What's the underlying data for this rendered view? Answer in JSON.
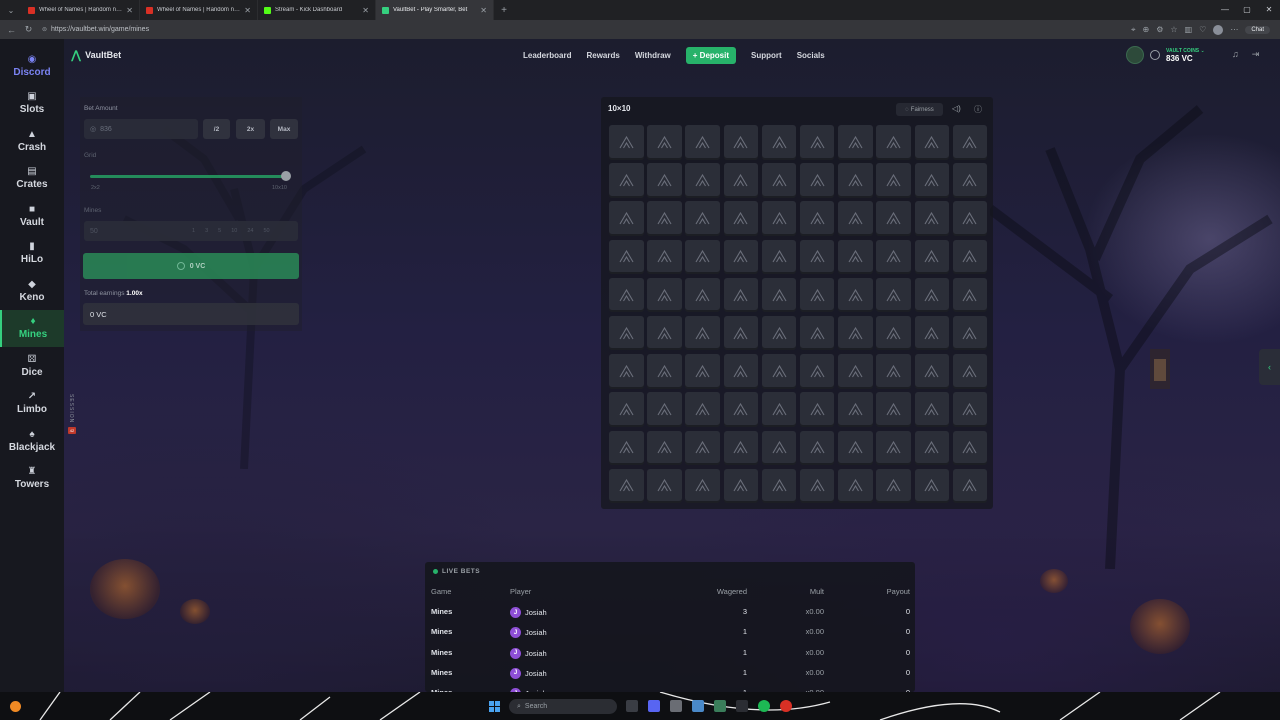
{
  "browser": {
    "tabs": [
      {
        "title": "Wheel of Names | Random name",
        "active": false,
        "color": "#d93025"
      },
      {
        "title": "Wheel of Names | Random name",
        "active": false,
        "color": "#d93025"
      },
      {
        "title": "Stream - Kick Dashboard",
        "active": false,
        "color": "#53fc18"
      },
      {
        "title": "VaultBet - Play Smarter, Bet",
        "active": true,
        "color": "#35d07f"
      }
    ],
    "url": "https://vaultbet.win/game/mines",
    "chat_label": "Chat"
  },
  "sidebar": {
    "items": [
      {
        "label": "Discord",
        "icon": "discord-icon",
        "glyph": "◉"
      },
      {
        "label": "Slots",
        "icon": "slot-machine-icon",
        "glyph": "▣"
      },
      {
        "label": "Crash",
        "icon": "rocket-icon",
        "glyph": "▲"
      },
      {
        "label": "Crates",
        "icon": "crate-icon",
        "glyph": "▤"
      },
      {
        "label": "Vault",
        "icon": "vault-icon",
        "glyph": "■"
      },
      {
        "label": "HiLo",
        "icon": "cards-icon",
        "glyph": "▮"
      },
      {
        "label": "Keno",
        "icon": "keno-icon",
        "glyph": "◆"
      },
      {
        "label": "Mines",
        "icon": "gem-icon",
        "glyph": "♦"
      },
      {
        "label": "Dice",
        "icon": "dice-icon",
        "glyph": "⚄"
      },
      {
        "label": "Limbo",
        "icon": "trend-up-icon",
        "glyph": "↗"
      },
      {
        "label": "Blackjack",
        "icon": "card-icon",
        "glyph": "♠"
      },
      {
        "label": "Towers",
        "icon": "tower-icon",
        "glyph": "♜"
      }
    ],
    "active": "Mines",
    "session_label": "SESSION",
    "session_badge": "42"
  },
  "header": {
    "brand": "VaultBet",
    "nav": [
      "Leaderboard",
      "Rewards",
      "Withdraw"
    ],
    "deposit_label": "Deposit",
    "nav_after": [
      "Support",
      "Socials"
    ],
    "wallet_label": "VAULT COINS",
    "wallet_amount": "836 VC"
  },
  "controls": {
    "bet_amount_label": "Bet Amount",
    "bet_amount_value": "836",
    "half_label": "/2",
    "double_label": "2x",
    "max_label": "Max",
    "grid_label": "Grid",
    "grid_min": "2x2",
    "grid_max": "10x10",
    "grid_value_fraction": 1.0,
    "mines_label": "Mines",
    "mines_value": "50",
    "mines_options": [
      "1",
      "3",
      "5",
      "10",
      "24",
      "50"
    ],
    "start_label": "0 VC",
    "total_earnings_label": "Total earnings",
    "total_earnings_mult": "1.00x",
    "total_earnings_value": "0 VC"
  },
  "board": {
    "title": "10×10",
    "fairness_label": "Fairness",
    "rows": 10,
    "cols": 10
  },
  "live_bets": {
    "title": "LIVE BETS",
    "columns": [
      "Game",
      "Player",
      "Wagered",
      "Mult",
      "Payout"
    ],
    "rows": [
      {
        "game": "Mines",
        "avatar": "J",
        "player": "Josiah",
        "wagered": "3",
        "mult": "x0.00",
        "payout": "0"
      },
      {
        "game": "Mines",
        "avatar": "J",
        "player": "Josiah",
        "wagered": "1",
        "mult": "x0.00",
        "payout": "0"
      },
      {
        "game": "Mines",
        "avatar": "J",
        "player": "Josiah",
        "wagered": "1",
        "mult": "x0.00",
        "payout": "0"
      },
      {
        "game": "Mines",
        "avatar": "J",
        "player": "Josiah",
        "wagered": "1",
        "mult": "x0.00",
        "payout": "0"
      },
      {
        "game": "Mines",
        "avatar": "J",
        "player": "Josiah",
        "wagered": "1",
        "mult": "x0.00",
        "payout": "0"
      }
    ]
  },
  "taskbar": {
    "search_placeholder": "Search"
  },
  "colors": {
    "accent": "#35d07f",
    "deposit": "#27b26a",
    "player_avatar": "#8e4fd6"
  }
}
